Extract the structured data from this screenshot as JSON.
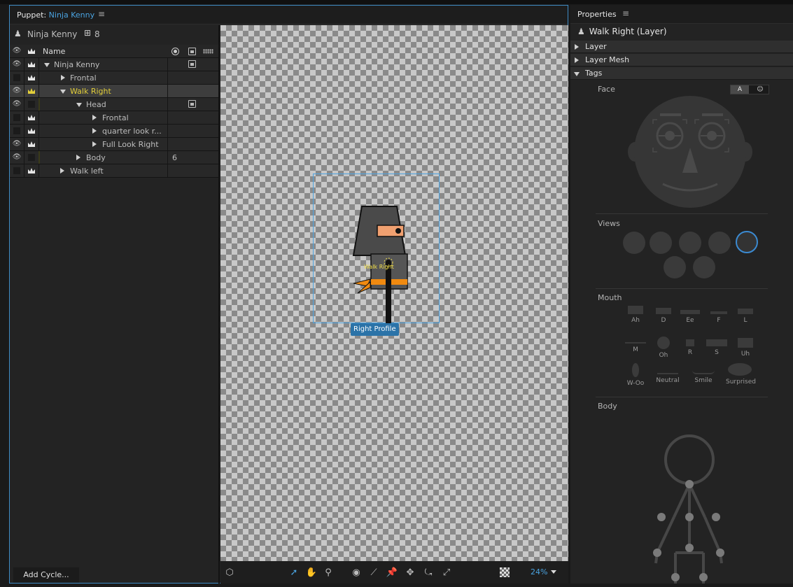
{
  "puppet_panel": {
    "header_prefix": "Puppet:",
    "header_puppet": "Ninja Kenny",
    "puppet_name": "Ninja Kenny",
    "puppet_count": "8",
    "column_name": "Name",
    "rows": [
      {
        "label": "Ninja Kenny",
        "extra": ""
      },
      {
        "label": "Frontal",
        "extra": ""
      },
      {
        "label": "Walk Right",
        "extra": ""
      },
      {
        "label": "Head",
        "extra": ""
      },
      {
        "label": "Frontal",
        "extra": ""
      },
      {
        "label": "quarter look r...",
        "extra": ""
      },
      {
        "label": "Full Look Right",
        "extra": ""
      },
      {
        "label": "Body",
        "extra": "6"
      },
      {
        "label": "Walk left",
        "extra": ""
      }
    ],
    "add_cycle_label": "Add Cycle..."
  },
  "canvas": {
    "selection_label": "Right Profile",
    "layer_tag": "Walk Right",
    "zoom": "24%"
  },
  "properties": {
    "header": "Properties",
    "layer_title": "Walk Right (Layer)",
    "sections": [
      "Layer",
      "Layer Mesh",
      "Tags"
    ],
    "face_label": "Face",
    "face_toggle_a": "A",
    "views_label": "Views",
    "mouth_label": "Mouth",
    "mouth_shapes": [
      "Ah",
      "D",
      "Ee",
      "F",
      "L",
      "M",
      "Oh",
      "R",
      "S",
      "Uh",
      "W-Oo",
      "Neutral",
      "Smile",
      "Surprised"
    ],
    "body_label": "Body"
  },
  "colors": {
    "accent": "#4aa3e0",
    "selected_yellow": "#e3cf3a",
    "selection_box": "#4da3e0"
  }
}
